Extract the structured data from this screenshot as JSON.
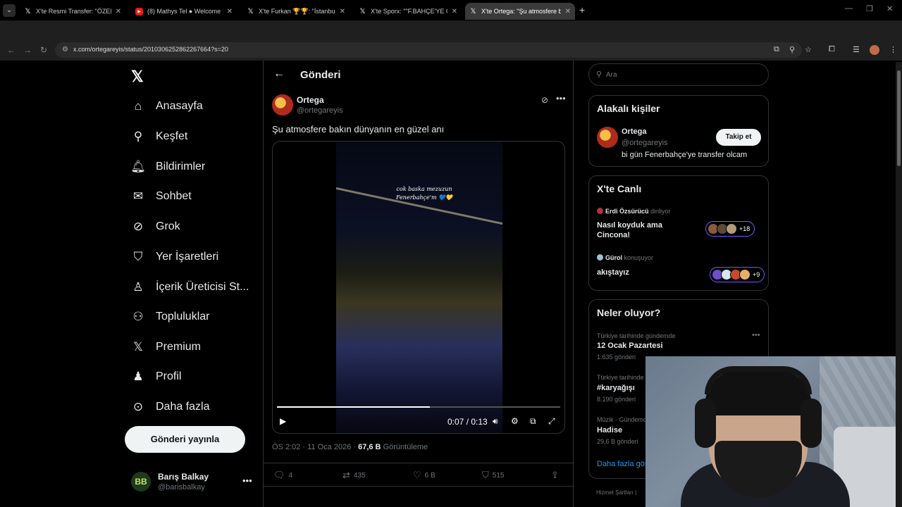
{
  "browser": {
    "tabs": [
      {
        "title": "X'te Resmi Transfer: \"ÖZEL| Fenerbahçe",
        "icon": "x-logo-icon"
      },
      {
        "title": "(8) Mathys Tel ● Welcome to Ga",
        "icon": "youtube-icon"
      },
      {
        "title": "X'te Furkan 🏆🏆: \"İstanbul'da",
        "icon": "x-logo-icon"
      },
      {
        "title": "X'te Sporx: \"\"F.BAHÇE'YE GELME",
        "icon": "x-logo-icon"
      },
      {
        "title": "X'te Ortega: \"Şu atmosfere bakın",
        "icon": "x-logo-icon"
      }
    ],
    "url": "x.com/ortegareyis/status/2010306252862267664?s=20"
  },
  "nav": {
    "logo": "𝕏",
    "items": [
      {
        "label": "Anasayfa",
        "icon": "home-icon",
        "glyph": "⌂"
      },
      {
        "label": "Keşfet",
        "icon": "search-icon",
        "glyph": "⚲"
      },
      {
        "label": "Bildirimler",
        "icon": "bell-icon",
        "glyph": "🔔︎"
      },
      {
        "label": "Sohbet",
        "icon": "mail-icon",
        "glyph": "✉"
      },
      {
        "label": "Grok",
        "icon": "grok-icon",
        "glyph": "⊘"
      },
      {
        "label": "Yer İşaretleri",
        "icon": "bookmark-icon",
        "glyph": "⛉"
      },
      {
        "label": "İçerik Üreticisi St...",
        "icon": "creator-studio-icon",
        "glyph": "♙"
      },
      {
        "label": "Topluluklar",
        "icon": "communities-icon",
        "glyph": "⚇"
      },
      {
        "label": "Premium",
        "icon": "premium-icon",
        "glyph": "𝕏"
      },
      {
        "label": "Profil",
        "icon": "profile-icon",
        "glyph": "♟"
      },
      {
        "label": "Daha fazla",
        "icon": "more-circle-icon",
        "glyph": "⊙"
      }
    ],
    "post_button": "Gönderi yayınla",
    "account": {
      "name": "Barış Balkay",
      "handle": "@barisbalkay",
      "initials": "BB"
    }
  },
  "post": {
    "header_title": "Gönderi",
    "author": {
      "name": "Ortega",
      "handle": "@ortegareyis"
    },
    "text": "Şu atmosfere bakın dünyanın en güzel anı",
    "video": {
      "caption": "cok baska mezuzun Fenerbahçe'm 💙💛",
      "time": "0:07 / 0:13",
      "progress": 0.54
    },
    "time": "ÖS 2:02 · 11 Oca 2026 · ",
    "views": "67,6 B",
    "views_label": " Görüntüleme",
    "stats": {
      "replies": "4",
      "reposts": "435",
      "likes": "6 B",
      "bookmarks": "515"
    }
  },
  "sidebar": {
    "search_placeholder": "Ara",
    "related": {
      "title": "Alakalı kişiler",
      "name": "Ortega",
      "handle": "@ortegareyis",
      "bio": "bi gün Fenerbahçe'ye transfer olcam",
      "follow": "Takip et"
    },
    "live": {
      "title": "X'te Canlı",
      "items": [
        {
          "user": "Erdi Özsürücü",
          "status": "dinliyor",
          "title": "Nasıl koyduk ama Cincona!",
          "count": "+18"
        },
        {
          "user": "Gürol",
          "status": "konuşuyor",
          "title": "akıştayız",
          "count": "+9"
        }
      ]
    },
    "trends": {
      "title": "Neler oluyor?",
      "items": [
        {
          "category": "Türkiye tarihinde gündemde",
          "name": "12 Ocak Pazartesi",
          "count": "1.635 gönderi"
        },
        {
          "category": "Türkiye tarihinde gündemde",
          "name": "#karyağışı",
          "count": "8.190 gönderi"
        },
        {
          "category": "Müzik · Gündemde",
          "name": "Hadise",
          "count": "29,6 B gönderi"
        }
      ],
      "show_more": "Daha fazla göster"
    },
    "footer": "Hizmet Şartları  |"
  }
}
